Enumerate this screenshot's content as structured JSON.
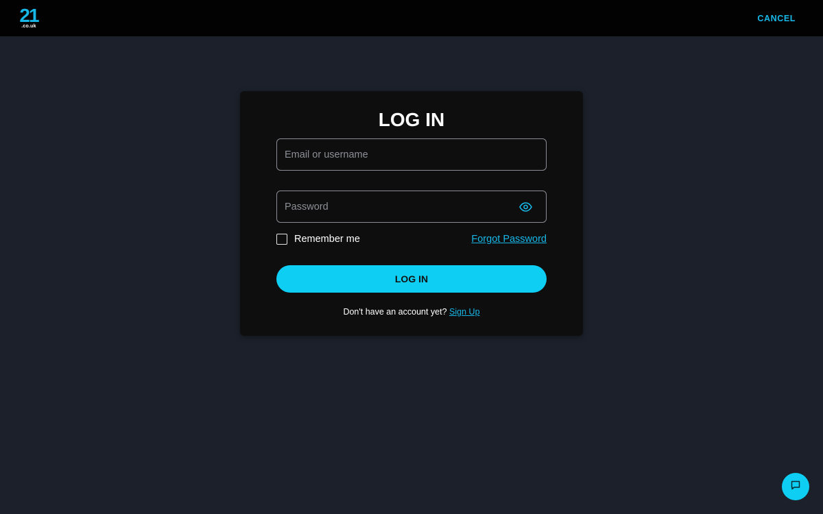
{
  "header": {
    "logo": {
      "number": "21",
      "suffix": ".co.uk"
    },
    "cancel_label": "CANCEL"
  },
  "login": {
    "title": "LOG IN",
    "email": {
      "placeholder": "Email or username",
      "value": ""
    },
    "password": {
      "placeholder": "Password",
      "value": "",
      "toggle_icon": "eye-icon"
    },
    "remember_me": {
      "label": "Remember me",
      "checked": false
    },
    "forgot_password_label": "Forgot Password",
    "submit_label": "LOG IN",
    "signup_prompt": "Don't have an account yet?",
    "signup_link_label": "Sign Up"
  },
  "chat": {
    "icon": "chat-icon"
  },
  "colors": {
    "accent": "#0ecff3",
    "link": "#17b8e8",
    "background": "#1b202a",
    "card": "#0e0e0f",
    "topbar": "#020203"
  }
}
